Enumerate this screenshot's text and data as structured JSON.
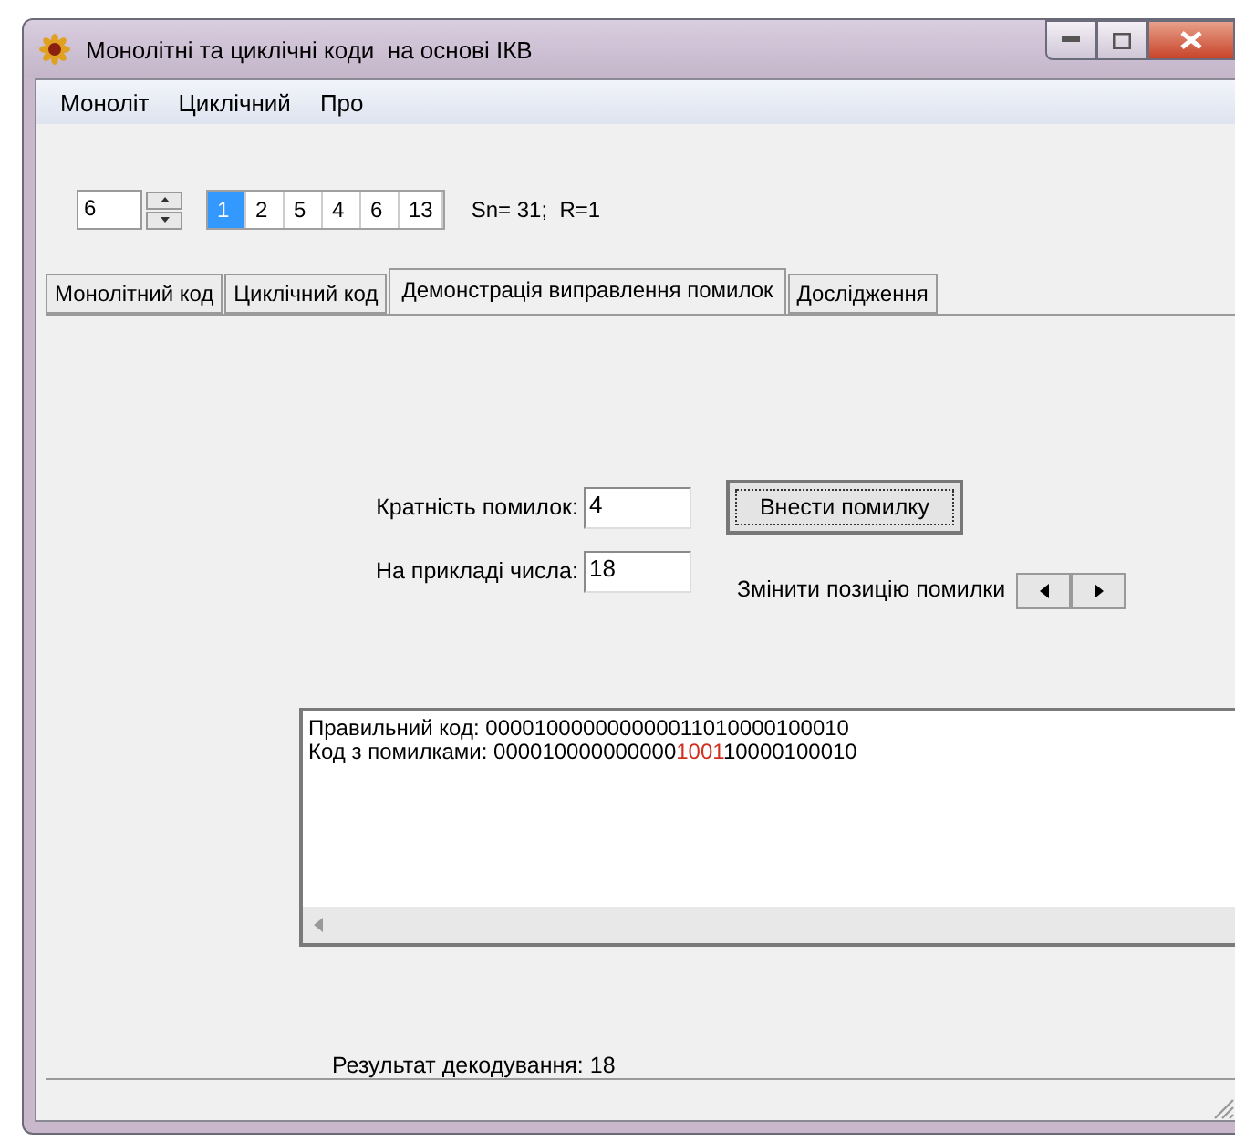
{
  "window": {
    "title": "Монолітні та циклічні коди  на основі ІКВ"
  },
  "menu": [
    "Моноліт",
    "Циклічний",
    "Про"
  ],
  "spinner": {
    "value": "6"
  },
  "numbers": [
    {
      "label": "1",
      "selected": true
    },
    {
      "label": "2",
      "selected": false
    },
    {
      "label": "5",
      "selected": false
    },
    {
      "label": "4",
      "selected": false
    },
    {
      "label": "6",
      "selected": false
    },
    {
      "label": "13",
      "selected": false
    }
  ],
  "summary": "Sn= 31;  R=1",
  "tabs": [
    {
      "label": "Монолітний код",
      "selected": false
    },
    {
      "label": "Циклічний код",
      "selected": false
    },
    {
      "label": "Демонстрація виправлення помилок",
      "selected": true
    },
    {
      "label": "Дослідження",
      "selected": false
    }
  ],
  "form": {
    "multiplicity_label": "Кратність помилок:",
    "multiplicity_value": "4",
    "number_label": "На прикладі числа:",
    "number_value": "18",
    "insert_button": "Внести помилку",
    "shift_label": "Змінити позицію помилки"
  },
  "output": [
    {
      "label": "Правильний код:",
      "segments": [
        {
          "text": "000010000000000011010000100010",
          "error": false
        }
      ]
    },
    {
      "label": "Код з помилками:",
      "segments": [
        {
          "text": "000010000000000",
          "error": false
        },
        {
          "text": "1001",
          "error": true
        },
        {
          "text": "10000100010",
          "error": false
        }
      ]
    }
  ],
  "result": "Результат декодування: 18"
}
